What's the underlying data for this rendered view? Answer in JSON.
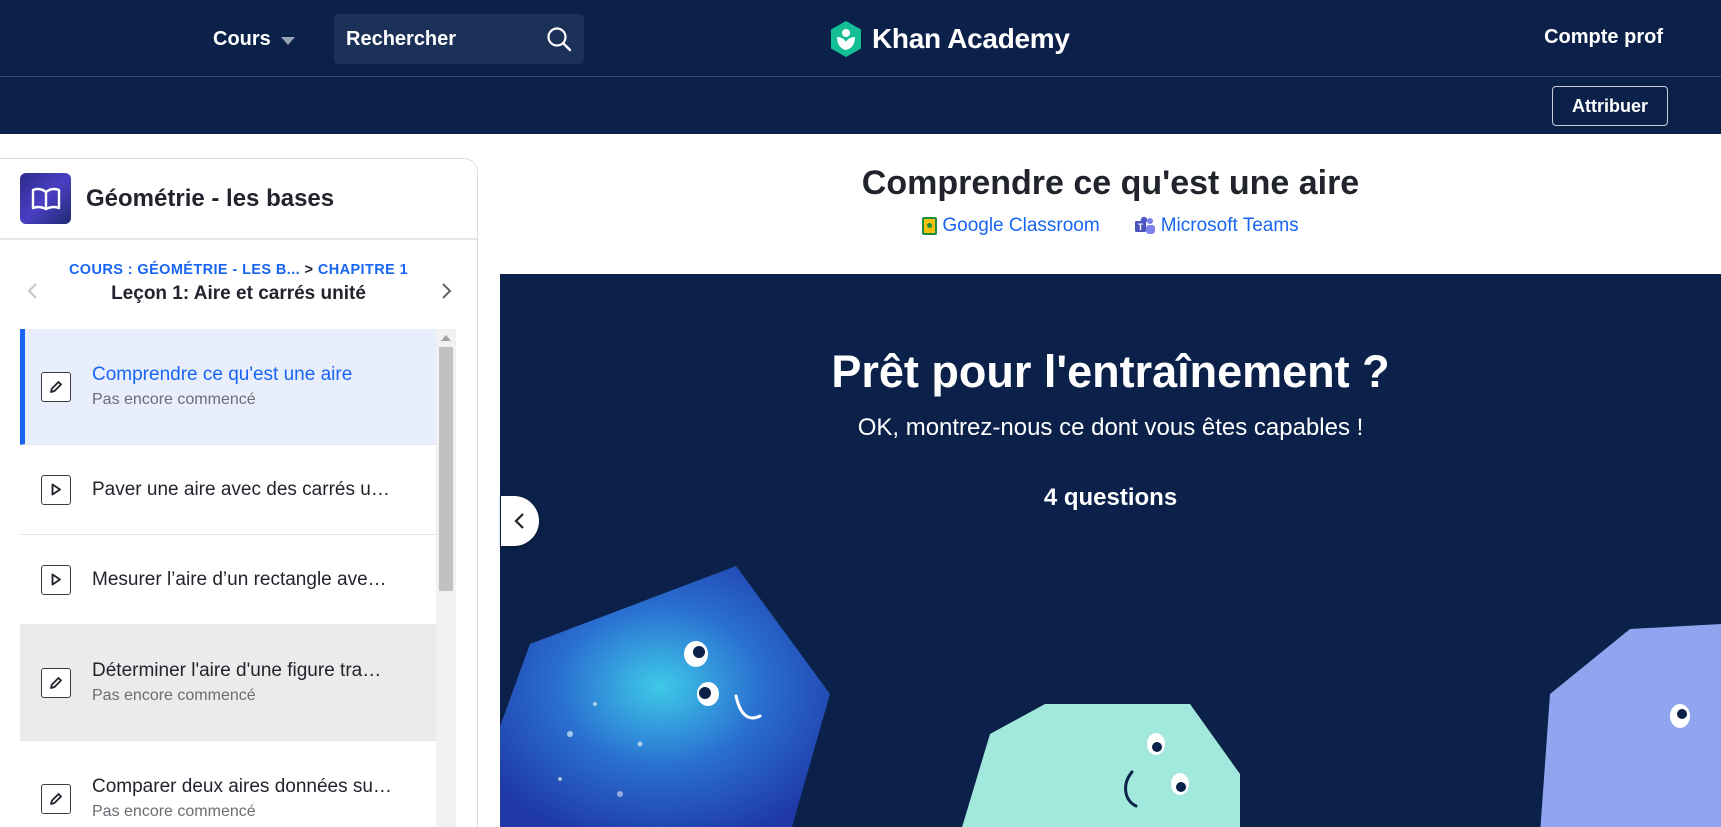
{
  "nav": {
    "courses_label": "Cours",
    "search_placeholder": "Rechercher",
    "logo_text": "Khan Academy",
    "account_label": "Compte prof",
    "assign_label": "Attribuer"
  },
  "sidebar": {
    "course_title": "Géométrie - les bases",
    "breadcrumb_course": "COURS : GÉOMÉTRIE - LES B...",
    "breadcrumb_sep": ">",
    "breadcrumb_chapter": "CHAPITRE 1",
    "lesson_title": "Leçon 1: Aire et carrés unité",
    "items": [
      {
        "title": "Comprendre ce qu'est une aire",
        "status": "Pas encore commencé",
        "type": "exercise-icon"
      },
      {
        "title": "Paver une aire avec des carrés un…",
        "status": "",
        "type": "video-icon"
      },
      {
        "title": "Mesurer l’aire d’un rectangle ave…",
        "status": "",
        "type": "video-icon"
      },
      {
        "title": "Déterminer l'aire d'une figure tra…",
        "status": "Pas encore commencé",
        "type": "exercise-icon"
      },
      {
        "title": "Comparer deux aires données su…",
        "status": "Pas encore commencé",
        "type": "exercise-icon"
      }
    ]
  },
  "main": {
    "title": "Comprendre ce qu'est une aire",
    "share_google": "Google Classroom",
    "share_teams": "Microsoft Teams",
    "practice_title": "Prêt pour l'entraînement ?",
    "practice_subtitle": "OK, montrez-nous ce dont vous êtes capables !",
    "practice_count": "4 questions"
  },
  "colors": {
    "navy": "#0b2149",
    "accent_blue": "#1865f2",
    "logo_green": "#14bf96"
  }
}
